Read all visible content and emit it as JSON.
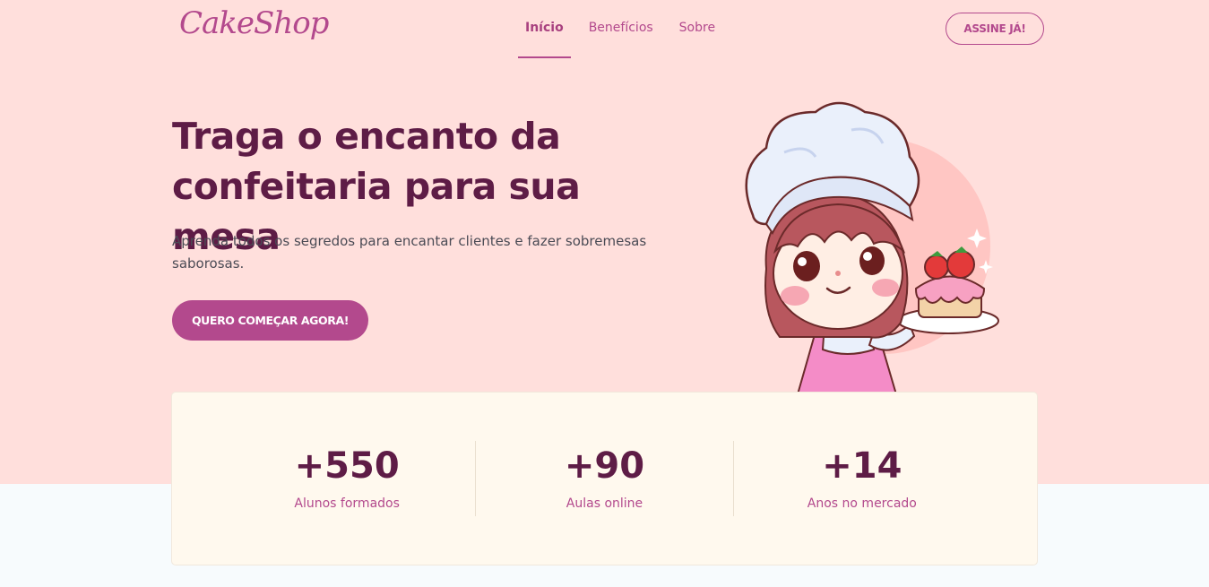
{
  "brand": {
    "logo": "CakeShop"
  },
  "nav": {
    "items": [
      {
        "label": "Início"
      },
      {
        "label": "Benefícios"
      },
      {
        "label": "Sobre"
      }
    ],
    "subscribe_label": "ASSINE JÁ!"
  },
  "hero": {
    "title": "Traga o encanto da confeitaria para sua mesa",
    "subtitle": "Aprenda todos os segredos para encantar clientes e fazer sobremesas saborosas.",
    "cta_label": "QUERO COMEÇAR AGORA!"
  },
  "stats": [
    {
      "value": "+550",
      "label": "Alunos formados"
    },
    {
      "value": "+90",
      "label": "Aulas online"
    },
    {
      "value": "+14",
      "label": "Anos no mercado"
    }
  ],
  "colors": {
    "hero_bg": "#ffdfdc",
    "accent": "#b3498d",
    "heading": "#5e1c46",
    "card_bg": "#fff9ee",
    "page_bg": "#f7fbfd"
  }
}
